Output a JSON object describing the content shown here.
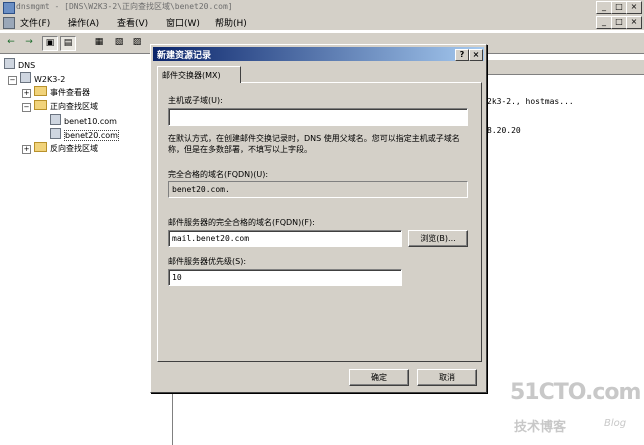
{
  "window": {
    "title": "dnsmgmt - [DNS\\W2K3-2\\正向查找区域\\benet20.com]",
    "controls": [
      "_",
      "□",
      "×"
    ],
    "child_controls": [
      "_",
      "□",
      "×"
    ]
  },
  "menu": [
    "文件(F)",
    "操作(A)",
    "查看(V)",
    "窗口(W)",
    "帮助(H)"
  ],
  "toolbar": [
    "←",
    "→",
    "▣",
    "▤",
    "▦",
    "▧",
    "▨"
  ],
  "tree": {
    "root": "DNS",
    "server": "W2K3-2",
    "items": [
      "事件查看器",
      "正向查找区域",
      "benet10.com",
      "benet20.com",
      "反向查找区域"
    ]
  },
  "right_pane": {
    "line1": "2k3-2., hostmas...",
    "line2": "8.20.20"
  },
  "dialog": {
    "title": "新建资源记录",
    "help": "?",
    "close": "×",
    "tab": "邮件交换器(MX)",
    "host_label": "主机或子域(U):",
    "host_value": "",
    "hint": "在默认方式，在创建邮件交换记录时，DNS 使用父域名。您可以指定主机或子域名称，但是在多数部署，不填写以上字段。",
    "fqdn_label": "完全合格的域名(FQDN)(U):",
    "fqdn_value": "benet20.com.",
    "mail_label": "邮件服务器的完全合格的域名(FQDN)(F):",
    "mail_value": "mail.benet20.com",
    "browse": "浏览(B)...",
    "priority_label": "邮件服务器优先级(S):",
    "priority_value": "10",
    "ok": "确定",
    "cancel": "取消"
  },
  "watermark": {
    "site": "51CTO.com",
    "sub": "技术博客",
    "blog": "Blog"
  }
}
